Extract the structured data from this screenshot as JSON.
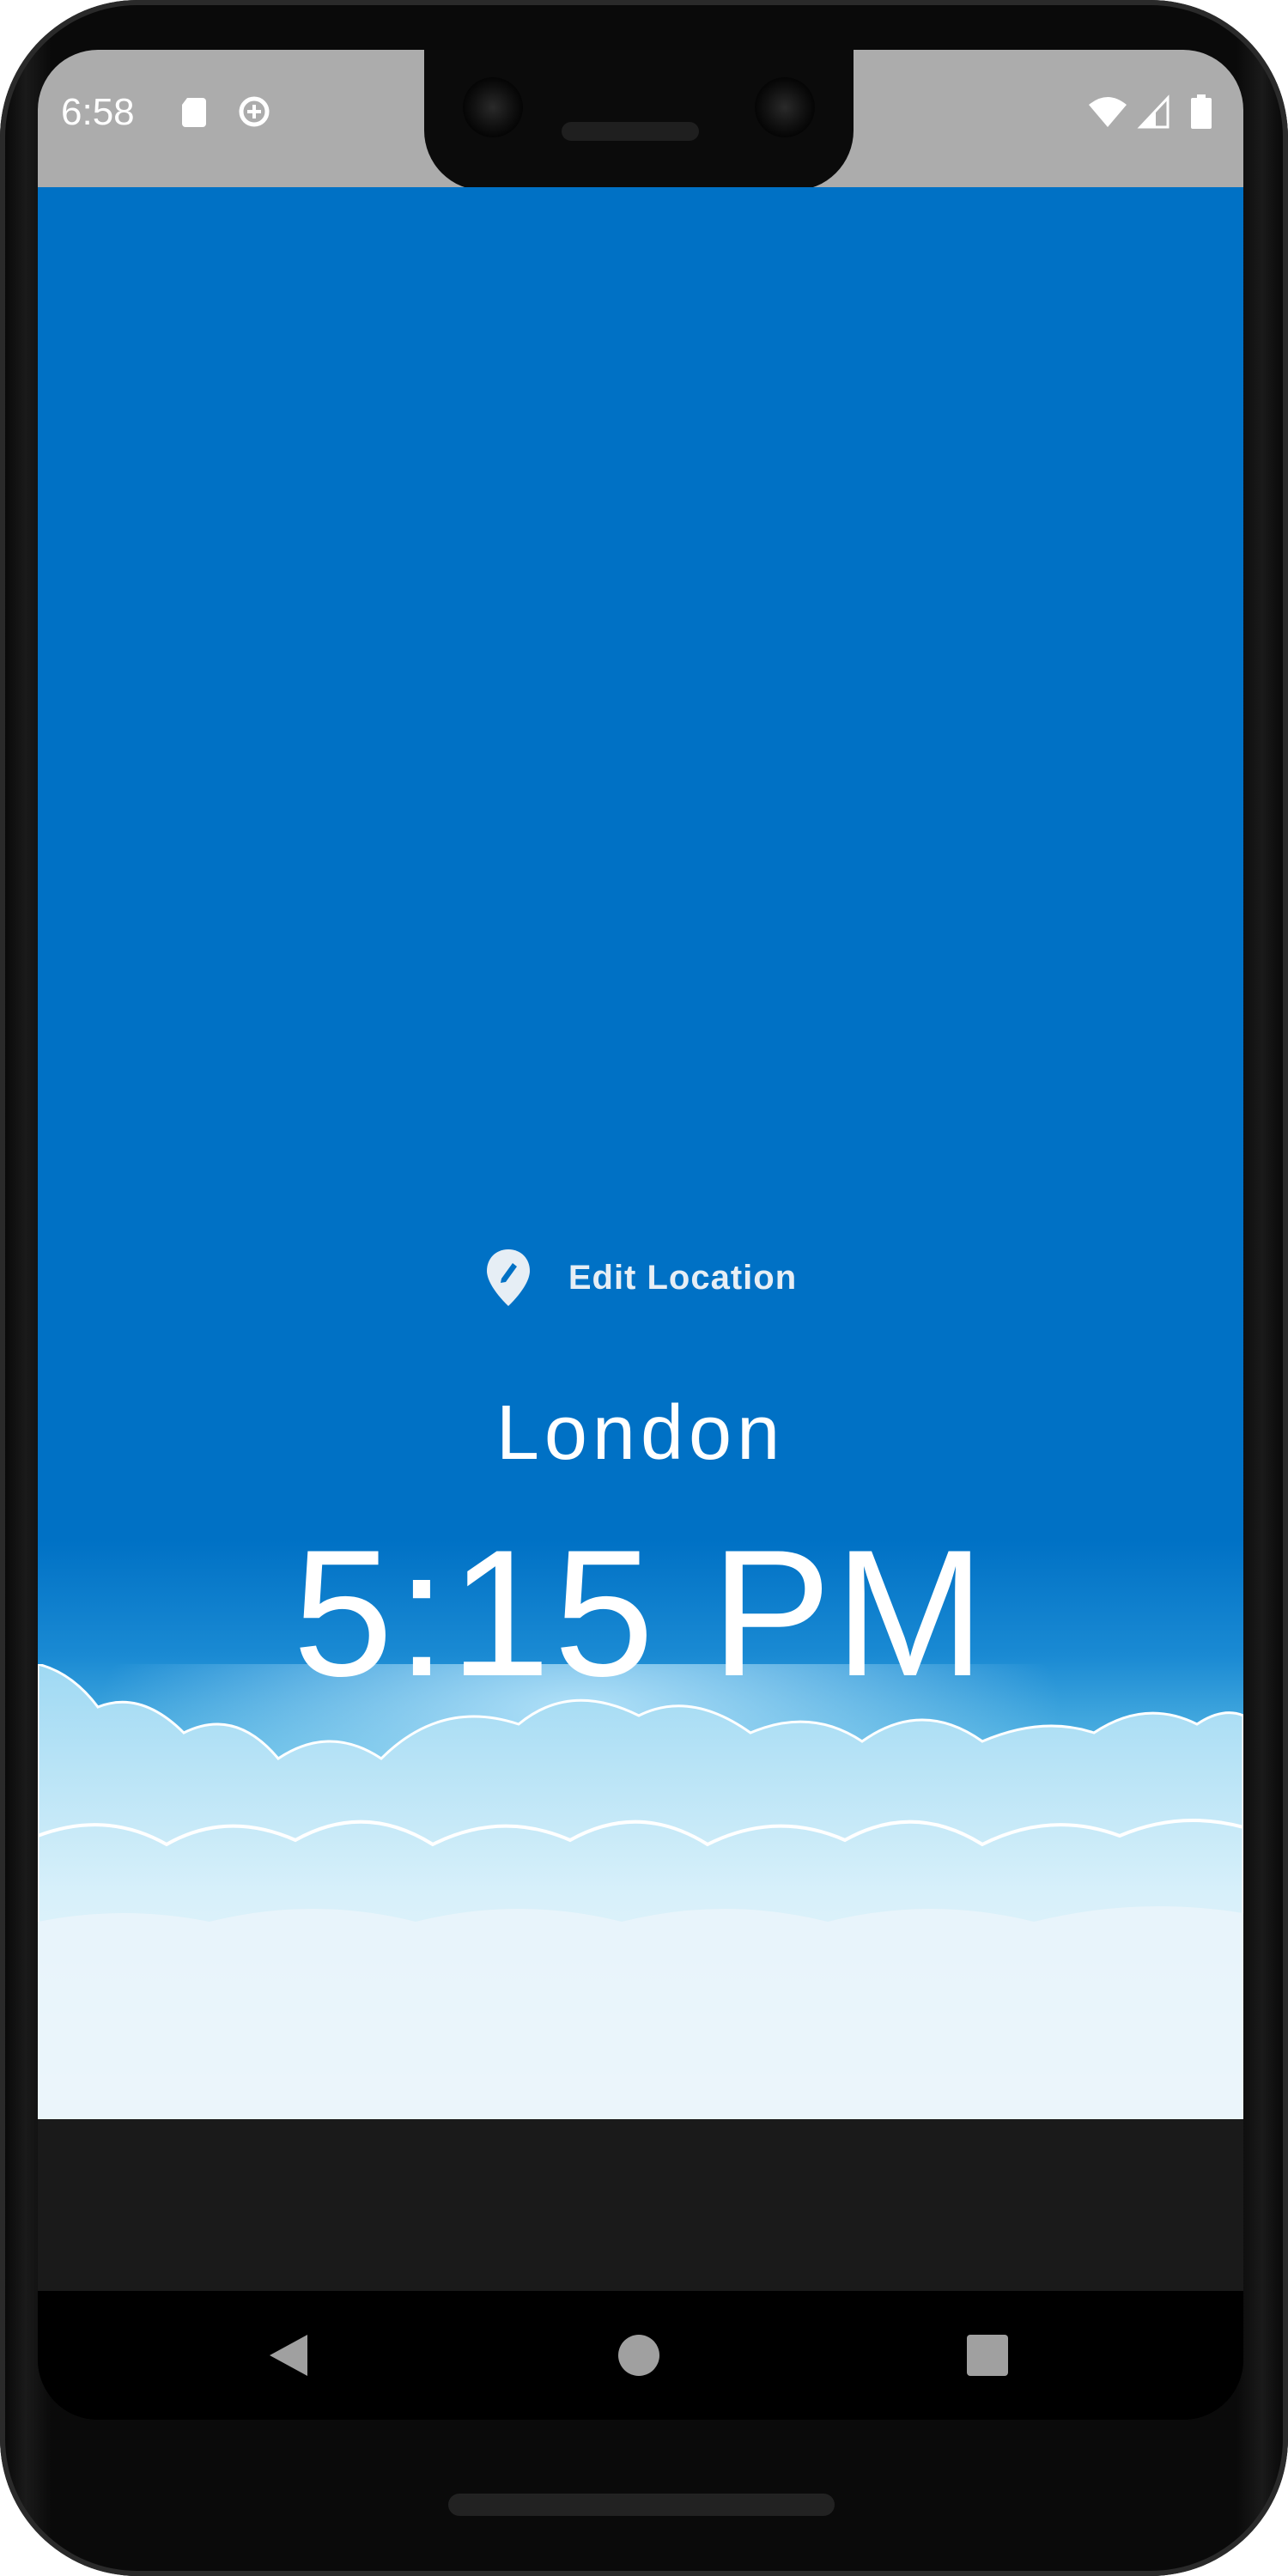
{
  "status_bar": {
    "time": "6:58",
    "left_icons": [
      "sd-card-icon",
      "data-saver-icon"
    ],
    "right_icons": [
      "wifi-icon",
      "signal-icon",
      "battery-icon"
    ]
  },
  "location": {
    "edit_label": "Edit Location",
    "icon": "edit-location-icon"
  },
  "city": "London",
  "time": "5:15 PM",
  "colors": {
    "sky": "#0071c5",
    "status_bar": "#acacac",
    "text": "#ffffff"
  },
  "nav": {
    "buttons": [
      "back-icon",
      "home-icon",
      "recents-icon"
    ]
  }
}
